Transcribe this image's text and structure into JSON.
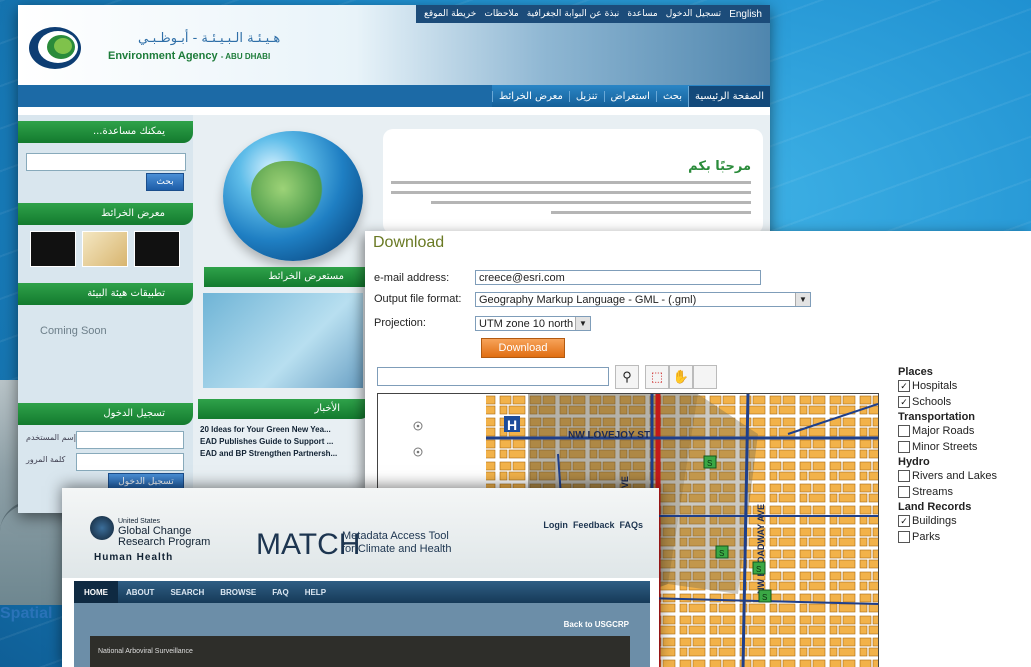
{
  "background": {
    "caption": "Spatial"
  },
  "ead": {
    "top_links": [
      "English",
      "تسجيل الدخول",
      "مساعدة",
      "نبذة عن البوابة الجغرافية",
      "ملاحظات",
      "خريطة الموقع"
    ],
    "name_ar": "هـيـئـة الـبـيـئـة - أبـوظـبـي",
    "name_en": "Environment Agency",
    "name_en_suffix": "- ABU DHABI",
    "nav": [
      "الصفحة الرئيسية",
      "بحث",
      "استعراض",
      "تنزيل",
      "معرض الخرائط"
    ],
    "sections": {
      "search": "...يمكنك مساعدة",
      "search_btn": "بحث",
      "gallery": "معرض الخرائط",
      "apps": "تطبيقات هيئة البيئة",
      "coming_soon": "Coming Soon",
      "login": "تسجيل الدخول",
      "username_label": "إسم المستخدم",
      "password_label": "كلمة المرور",
      "login_btn": "تسجيل الدخول",
      "viewer": "مستعرض الخرائط",
      "news": "الأخبار"
    },
    "welcome_title": "مرحبًا بكم",
    "news_items": [
      "20 Ideas for Your Green New Yea...",
      "EAD Publishes Guide to Support ...",
      "EAD and BP Strengthen Partnersh..."
    ]
  },
  "download": {
    "title": "Download",
    "email_label": "e-mail address:",
    "email_value": "creece@esri.com",
    "format_label": "Output file format:",
    "format_value": "Geography Markup Language - GML - (.gml)",
    "projection_label": "Projection:",
    "projection_value": "UTM zone 10 north",
    "download_btn": "Download",
    "map_labels": {
      "street1": "NW LOVEJOY ST",
      "street2": "NW BROADWAY AVE",
      "ave": "AVE",
      "hospital": "H",
      "school": "S"
    },
    "layers": [
      {
        "group": "Places",
        "items": [
          {
            "label": "Hospitals",
            "checked": true
          },
          {
            "label": "Schools",
            "checked": true
          }
        ]
      },
      {
        "group": "Transportation",
        "items": [
          {
            "label": "Major Roads",
            "checked": false
          },
          {
            "label": "Minor Streets",
            "checked": false
          }
        ]
      },
      {
        "group": "Hydro",
        "items": [
          {
            "label": "Rivers and Lakes",
            "checked": false
          },
          {
            "label": "Streams",
            "checked": false
          }
        ]
      },
      {
        "group": "Land Records",
        "items": [
          {
            "label": "Buildings",
            "checked": true
          },
          {
            "label": "Parks",
            "checked": false
          }
        ]
      }
    ]
  },
  "match": {
    "org_line1": "United States",
    "org_line2": "Global Change",
    "org_line3": "Research Program",
    "human_health": "Human Health",
    "title": "MATCH",
    "subtitle_line1": "Metadata Access Tool",
    "subtitle_line2": "for Climate and Health",
    "top_links": [
      "Login",
      "Feedback",
      "FAQs"
    ],
    "nav": [
      "HOME",
      "ABOUT",
      "SEARCH",
      "BROWSE",
      "FAQ",
      "HELP"
    ],
    "back_link": "Back to USGCRP",
    "panel_caption": "National Arboviral Surveillance"
  }
}
